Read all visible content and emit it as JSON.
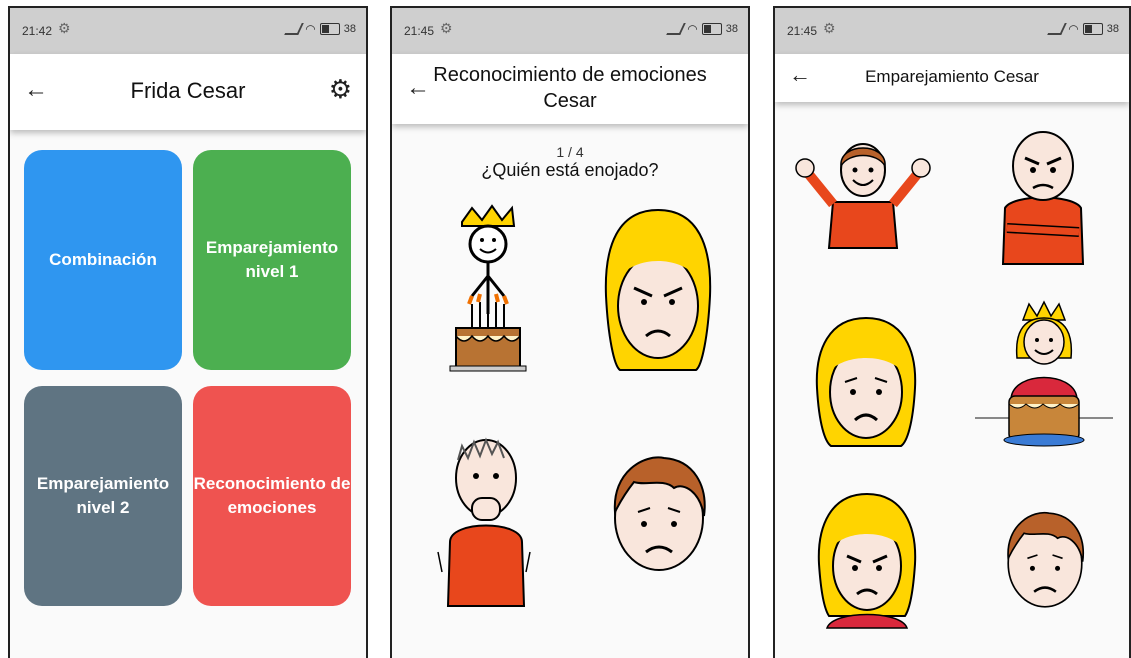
{
  "colors": {
    "combinacion": "#2f96f0",
    "emparejamiento1": "#4caf50",
    "emparejamiento2": "#5f7482",
    "reconocimiento": "#ef5350"
  },
  "screen1": {
    "status_time": "21:42",
    "battery": "38",
    "title": "Frida Cesar",
    "tiles": [
      {
        "label": "Combinación"
      },
      {
        "label": "Emparejamiento nivel 1"
      },
      {
        "label": "Emparejamiento nivel 2"
      },
      {
        "label": "Reconocimiento de emociones"
      }
    ]
  },
  "screen2": {
    "status_time": "21:45",
    "battery": "38",
    "title": "Reconocimiento de emociones Cesar",
    "counter": "1 / 4",
    "question": "¿Quién está enojado?",
    "pictograms": [
      "king-birthday-pictogram",
      "angry-girl-pictogram",
      "scared-boy-pictogram",
      "sad-boy-pictogram"
    ]
  },
  "screen3": {
    "status_time": "21:45",
    "battery": "38",
    "title": "Emparejamiento Cesar",
    "pictograms": [
      "happy-boy-pictogram",
      "angry-man-pictogram",
      "sad-girl-pictogram",
      "queen-birthday-pictogram",
      "angry-girl-pictogram",
      "sad-boy-pictogram"
    ]
  }
}
